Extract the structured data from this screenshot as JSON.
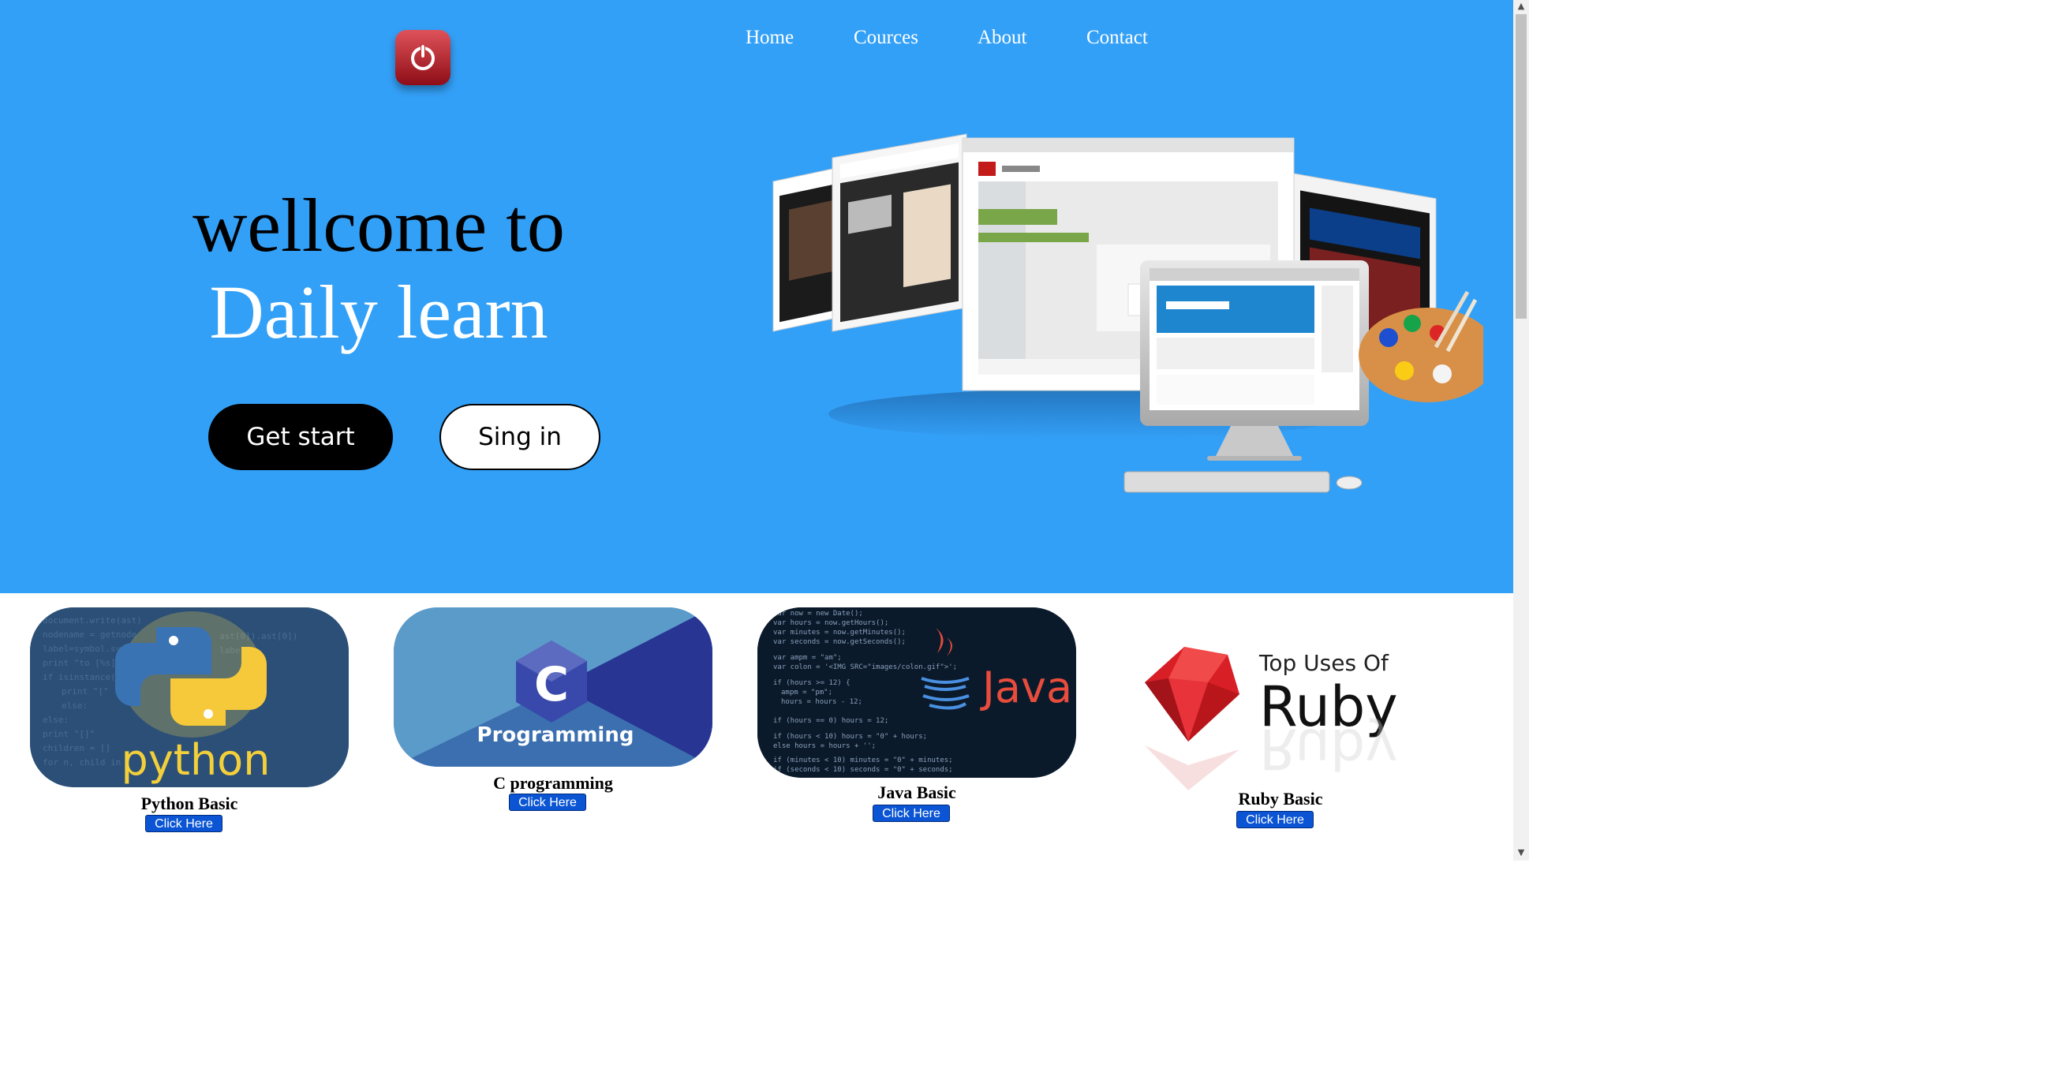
{
  "nav": {
    "items": [
      {
        "label": "Home"
      },
      {
        "label": "Cources"
      },
      {
        "label": "About"
      },
      {
        "label": "Contact"
      }
    ]
  },
  "hero": {
    "headline_line1": "wellcome to",
    "headline_line2": "Daily learn",
    "primary_button": "Get start",
    "secondary_button": "Sing in",
    "background_color": "#33a0f7"
  },
  "courses": [
    {
      "title": "Python Basic",
      "button": "Click Here",
      "image_text": "python",
      "icon": "python-logo-icon"
    },
    {
      "title": "C programming",
      "button": "Click Here",
      "image_text": "Programming",
      "icon": "c-logo-icon"
    },
    {
      "title": "Java Basic",
      "button": "Click Here",
      "image_text": "Java",
      "icon": "java-logo-icon"
    },
    {
      "title": "Ruby Basic",
      "button": "Click Here",
      "image_text_1": "Top Uses Of",
      "image_text_2": "Ruby",
      "icon": "ruby-gem-icon"
    }
  ],
  "colors": {
    "button_blue": "#0b55d4",
    "logo_red": "#c21f28"
  }
}
